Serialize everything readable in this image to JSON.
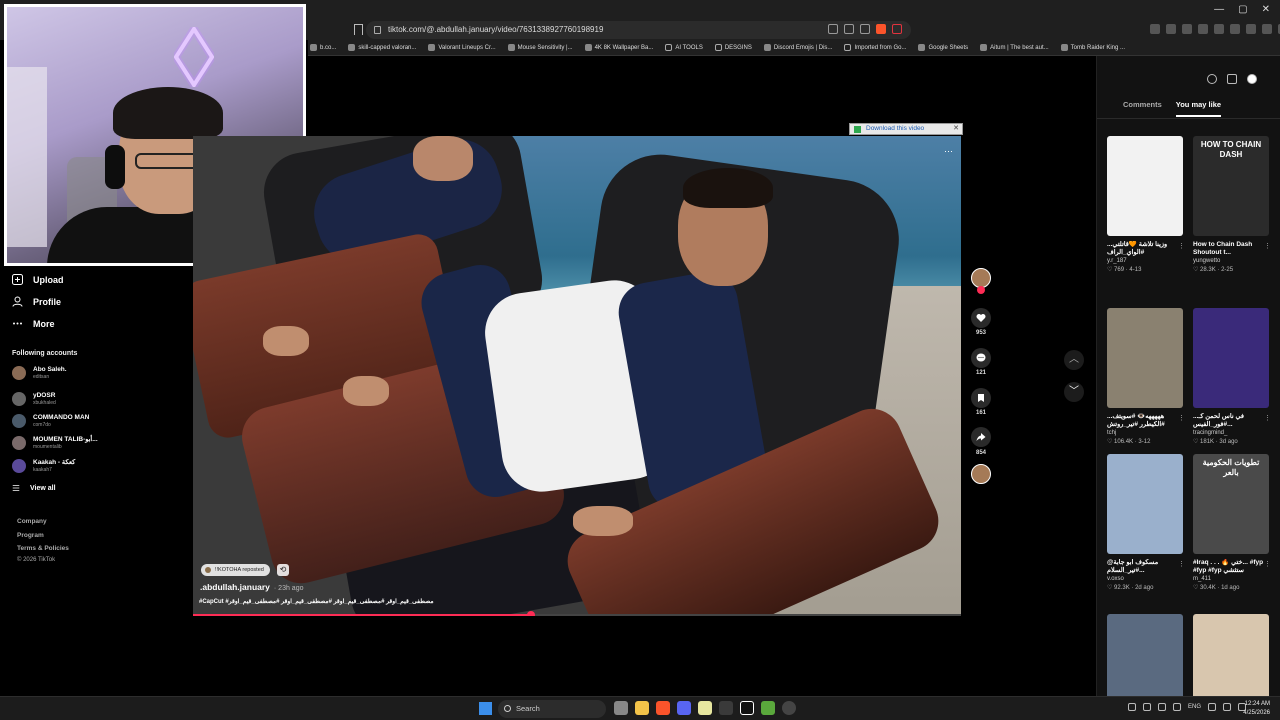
{
  "browser": {
    "url": "tiktok.com/@.abdullah.january/video/7631338927760198919",
    "bookmarks": [
      {
        "label": "b.co...",
        "icon": "page-icon"
      },
      {
        "label": "skill-capped valoran...",
        "icon": "page-icon"
      },
      {
        "label": "Valorant Lineups Cr...",
        "icon": "page-icon"
      },
      {
        "label": "Mouse Sensitivity |...",
        "icon": "page-icon"
      },
      {
        "label": "4K 8K Wallpaper Ba...",
        "icon": "page-icon"
      },
      {
        "label": "AI TOOLS",
        "icon": "folder-icon"
      },
      {
        "label": "DESGINS",
        "icon": "folder-icon"
      },
      {
        "label": "Discord Emojis | Dis...",
        "icon": "page-icon"
      },
      {
        "label": "Imported from Go...",
        "icon": "folder-icon"
      },
      {
        "label": "Google Sheets",
        "icon": "page-icon"
      },
      {
        "label": "Aitum | The best aut...",
        "icon": "page-icon"
      },
      {
        "label": "Tomb Raider King ...",
        "icon": "page-icon"
      }
    ],
    "window_controls": [
      "—",
      "▢",
      "✕"
    ]
  },
  "sidebar": {
    "nav": [
      {
        "label": "Upload",
        "icon": "upload-icon"
      },
      {
        "label": "Profile",
        "icon": "profile-icon"
      },
      {
        "label": "More",
        "icon": "more-icon"
      }
    ],
    "following_title": "Following accounts",
    "accounts": [
      {
        "name": "Abo Saleh.",
        "handle": "editsan",
        "color": "#8a6b55"
      },
      {
        "name": "yDOSR",
        "handle": "xbukhaled",
        "color": "#666666"
      },
      {
        "name": "COMMANDO MAN",
        "handle": "com7do",
        "color": "#4a5a6a"
      },
      {
        "name": "MOUMEN TALIB-أبو...",
        "handle": "moumentalib",
        "color": "#7a6a6a"
      },
      {
        "name": "Kaakah - كعكة",
        "handle": "kaakah7",
        "color": "#5a4a9a"
      }
    ],
    "view_all": "View all",
    "footer": [
      "Company",
      "Program",
      "Terms & Policies",
      "© 2026 TikTok"
    ]
  },
  "video": {
    "download_bar": "Download this video",
    "repost_label": "!!KOTOHA reposted",
    "author": ".abdullah.january",
    "time": "· 23h ago",
    "caption": "#CapCut #مصطفى_قيم_اوقر #مصطفى_قيم_اوقر #مصطفى_قيم_اوقر #مصطفى_قيم_اوقر",
    "progress": 0.44
  },
  "actions": {
    "likes": "953",
    "comments": "121",
    "saves": "161",
    "shares": "854"
  },
  "right_panel": {
    "tabs": [
      {
        "label": "Comments",
        "active": false
      },
      {
        "label": "You may like",
        "active": true
      }
    ],
    "cards": [
      {
        "title": "وزينا تلاشة 🧡قاتلتي... #الواي_الراف",
        "user": "y.r_187",
        "likes": "769",
        "date": "4-13",
        "thumb_text": "",
        "bg": "#f2f2f2"
      },
      {
        "title": "How to Chain Dash Shoutout t...",
        "user": "yungwetto",
        "likes": "28.3K",
        "date": "2-25",
        "thumb_text": "HOW TO CHAIN DASH",
        "bg": "#2b2b2b"
      },
      {
        "title": "هههههه👁️ #سويتف... #الكيطرر #تير_روتش",
        "user": "tchj",
        "likes": "106.4K",
        "date": "3-12",
        "thumb_text": "",
        "bg": "#8a8170"
      },
      {
        "title": "في ناس لحمن كـ... #فور_الفيس...",
        "user": "tracingmind_",
        "likes": "181K",
        "date": "3d ago",
        "thumb_text": "",
        "bg": "#3a2a7a"
      },
      {
        "title": "مسكوف ابو جابة@ #تير_السلام...",
        "user": "v.oxso",
        "likes": "92.3K",
        "date": "2d ago",
        "thumb_text": "",
        "bg": "#9ab0cc"
      },
      {
        "title": "#Iraq . . . 🔥 ختي... #fyp #fyp #fyp ستثشي",
        "user": "m_411",
        "likes": "30.4K",
        "date": "1d ago",
        "thumb_text": "تطويات الحكومية بالعر",
        "bg": "#4a4a4a"
      },
      {
        "title": "",
        "user": "",
        "likes": "",
        "date": "",
        "thumb_text": "",
        "bg": "#5a6a80"
      },
      {
        "title": "",
        "user": "",
        "likes": "",
        "date": "",
        "thumb_text": "",
        "bg": "#d8c6ae"
      }
    ]
  },
  "taskbar": {
    "search": "Search",
    "lang": "ENG",
    "time": "12:24 AM",
    "date": "4/25/2026"
  }
}
